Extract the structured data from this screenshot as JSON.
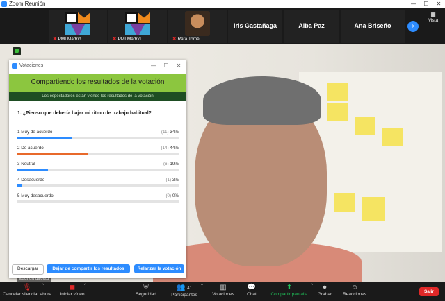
{
  "window": {
    "title": "Zoom Reunión",
    "controls": [
      "—",
      "☐",
      "✕"
    ]
  },
  "participants": [
    {
      "name": "PMI Madrid",
      "type": "logo"
    },
    {
      "name": "PMI Madrid",
      "type": "logo"
    },
    {
      "name": "Rafa Tomé",
      "type": "photo"
    },
    {
      "name": "Iris Gastañaga",
      "type": "text"
    },
    {
      "name": "Alba Paz",
      "type": "text"
    },
    {
      "name": "Ana Briseño",
      "type": "text"
    }
  ],
  "strip": {
    "more_icon": "›",
    "view_label": "Vista",
    "view_icon": "▦"
  },
  "video": {
    "speaker_name": "Saúl en directo"
  },
  "poll": {
    "window_title": "Votaciones",
    "controls": [
      "—",
      "☐",
      "✕"
    ],
    "banner": "Compartiendo los resultados de la votación",
    "subbanner": "Los espectadores están viendo los resultados de la votación",
    "question": "1. ¿Pienso que debería bajar mi ritmo de trabajo habitual?",
    "options": [
      {
        "label": "1 Muy de acuerdo",
        "count": "(11)",
        "percent": "34%",
        "value": 34,
        "color": "#2d8cff"
      },
      {
        "label": "2 De acuerdo",
        "count": "(14)",
        "percent": "44%",
        "value": 44,
        "color": "#e8692b"
      },
      {
        "label": "3 Neutral",
        "count": "(6)",
        "percent": "19%",
        "value": 19,
        "color": "#2d8cff"
      },
      {
        "label": "4 Desacuerdo",
        "count": "(1)",
        "percent": "3%",
        "value": 3,
        "color": "#2d8cff"
      },
      {
        "label": "5 Muy desacuerdo",
        "count": "(0)",
        "percent": "0%",
        "value": 0,
        "color": "#2d8cff"
      }
    ],
    "download_label": "Descargar",
    "stop_share_label": "Dejar de compartir los resultados",
    "relaunch_label": "Relanzar la votación"
  },
  "toolbar": {
    "unmute": "Cancelar silenciar ahora",
    "start_video": "Iniciar vídeo",
    "security": "Seguridad",
    "participants": "Participantes",
    "participants_count": "41",
    "polls": "Votaciones",
    "chat": "Chat",
    "share": "Compartir pantalla",
    "record": "Grabar",
    "reactions": "Reacciones",
    "exit": "Salir"
  },
  "colors": {
    "accent": "#2d8cff",
    "banner": "#8cc63f",
    "subbanner": "#1e4d23",
    "exit": "#e02828",
    "share": "#1fc25a"
  }
}
